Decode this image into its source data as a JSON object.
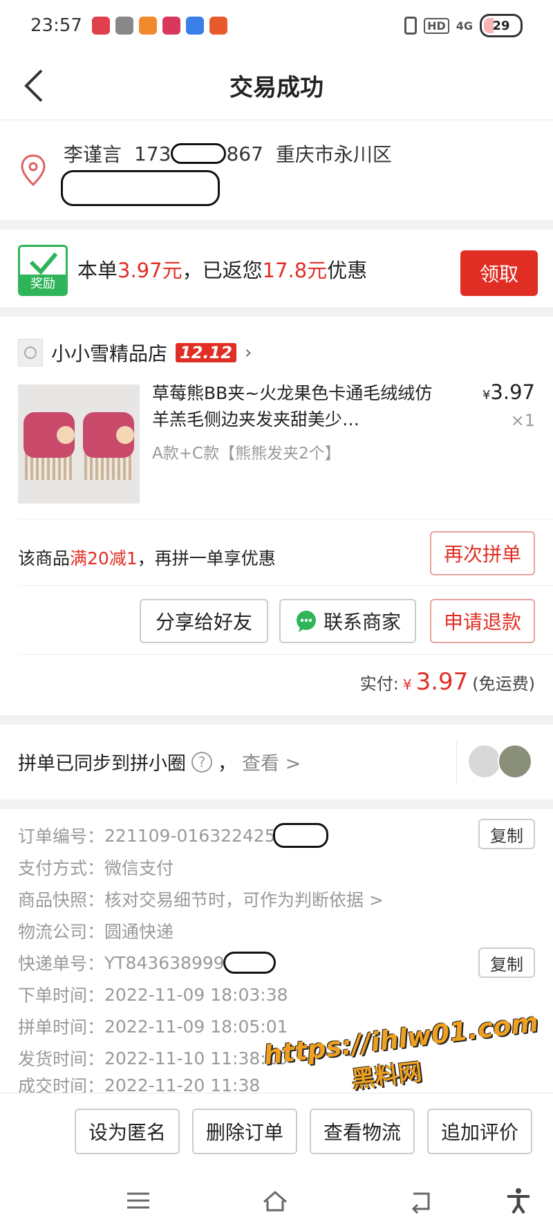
{
  "status_bar": {
    "time": "23:57",
    "network": "4G",
    "battery": "29"
  },
  "nav": {
    "title": "交易成功",
    "back_icon": "chevron-left-icon"
  },
  "address": {
    "name": "李谨言",
    "phone_prefix": "173",
    "phone_suffix": "867",
    "district": "重庆市永川区",
    "icon": "location-pin-icon"
  },
  "reward": {
    "badge_label": "奖励",
    "prefix": "本单",
    "amount": "3.97元",
    "middle": "，已返您",
    "discount": "17.8元",
    "suffix": "优惠",
    "claim_button": "领取",
    "accent_color": "#e02e24",
    "badge_color": "#2fb45a"
  },
  "shop": {
    "name": "小小雪精品店",
    "tag": "12.12"
  },
  "product": {
    "title": "草莓熊BB夹~火龙果色卡通毛绒绒仿羊羔毛侧边夹发夹甜美少…",
    "variant": "A款+C款【熊熊发夹2个】",
    "currency": "¥",
    "price": "3.97",
    "qty": "×1"
  },
  "promo": {
    "prefix": "该商品",
    "highlight": "满20减1",
    "suffix": "，再拼一单享优惠",
    "button": "再次拼单"
  },
  "order_actions": {
    "share": "分享给好友",
    "contact": "联系商家",
    "refund": "申请退款"
  },
  "payment": {
    "label": "实付:",
    "currency": "¥",
    "amount": "3.97",
    "note": "(免运费)"
  },
  "sync": {
    "text": "拼单已同步到拼小圈",
    "help": "?",
    "separator": "，",
    "view": "查看 >"
  },
  "details": {
    "order_no": {
      "label": "订单编号：",
      "value": "221109-016322425",
      "copy": "复制"
    },
    "pay_method": {
      "label": "支付方式：",
      "value": "微信支付"
    },
    "snapshot": {
      "label": "商品快照：",
      "value": "核对交易细节时，可作为判断依据 >"
    },
    "logistics": {
      "label": "物流公司：",
      "value": "圆通快递"
    },
    "tracking_no": {
      "label": "快递单号：",
      "value": "YT843638999",
      "copy": "复制"
    },
    "order_time": {
      "label": "下单时间：",
      "value": "2022-11-09 18:03:38"
    },
    "group_time": {
      "label": "拼单时间：",
      "value": "2022-11-09 18:05:01"
    },
    "ship_time": {
      "label": "发货时间：",
      "value": "2022-11-10 11:38:10"
    },
    "deal_time": {
      "label": "成交时间：",
      "value": "2022-11-20 11:38"
    }
  },
  "watermark": {
    "url": "https://ihlw01.com",
    "name": "黑料网"
  },
  "bottom_actions": [
    "设为匿名",
    "删除订单",
    "查看物流",
    "追加评价"
  ],
  "system_nav": [
    "menu-icon",
    "home-icon",
    "back-icon",
    "accessibility-icon"
  ]
}
